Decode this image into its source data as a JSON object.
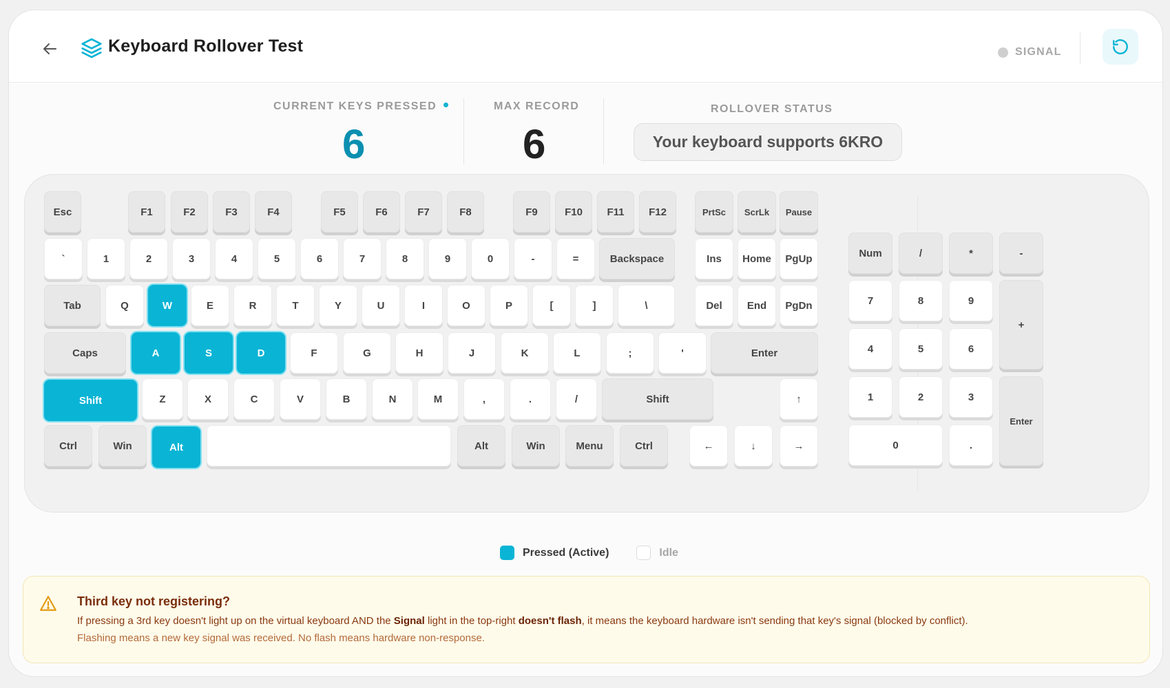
{
  "header": {
    "title": "Keyboard Rollover Test",
    "signal_label": "SIGNAL"
  },
  "stats": {
    "current_label": "CURRENT KEYS PRESSED",
    "current_value": "6",
    "max_label": "MAX RECORD",
    "max_value": "6",
    "status_label": "ROLLOVER STATUS",
    "status_text": "Your keyboard supports 6KRO"
  },
  "keyboard": {
    "keys": [
      {
        "id": "Esc",
        "label": "Esc"
      },
      {
        "id": "F1",
        "label": "F1"
      },
      {
        "id": "F2",
        "label": "F2"
      },
      {
        "id": "F3",
        "label": "F3"
      },
      {
        "id": "F4",
        "label": "F4"
      },
      {
        "id": "F5",
        "label": "F5"
      },
      {
        "id": "F6",
        "label": "F6"
      },
      {
        "id": "F7",
        "label": "F7"
      },
      {
        "id": "F8",
        "label": "F8"
      },
      {
        "id": "F9",
        "label": "F9"
      },
      {
        "id": "F10",
        "label": "F10"
      },
      {
        "id": "F11",
        "label": "F11"
      },
      {
        "id": "F12",
        "label": "F12"
      },
      {
        "id": "PrtSc",
        "label": "PrtSc"
      },
      {
        "id": "ScrLk",
        "label": "ScrLk"
      },
      {
        "id": "Pause",
        "label": "Pause"
      },
      {
        "id": "Backquote",
        "label": "`"
      },
      {
        "id": "1",
        "label": "1"
      },
      {
        "id": "2",
        "label": "2"
      },
      {
        "id": "3",
        "label": "3"
      },
      {
        "id": "4",
        "label": "4"
      },
      {
        "id": "5",
        "label": "5"
      },
      {
        "id": "6",
        "label": "6"
      },
      {
        "id": "7",
        "label": "7"
      },
      {
        "id": "8",
        "label": "8"
      },
      {
        "id": "9",
        "label": "9"
      },
      {
        "id": "0",
        "label": "0"
      },
      {
        "id": "Minus",
        "label": "-"
      },
      {
        "id": "Equal",
        "label": "="
      },
      {
        "id": "Backspace",
        "label": "Backspace"
      },
      {
        "id": "Ins",
        "label": "Ins"
      },
      {
        "id": "Home",
        "label": "Home"
      },
      {
        "id": "PgUp",
        "label": "PgUp"
      },
      {
        "id": "Tab",
        "label": "Tab"
      },
      {
        "id": "Q",
        "label": "Q"
      },
      {
        "id": "W",
        "label": "W"
      },
      {
        "id": "E",
        "label": "E"
      },
      {
        "id": "R",
        "label": "R"
      },
      {
        "id": "T",
        "label": "T"
      },
      {
        "id": "Y",
        "label": "Y"
      },
      {
        "id": "U",
        "label": "U"
      },
      {
        "id": "I",
        "label": "I"
      },
      {
        "id": "O",
        "label": "O"
      },
      {
        "id": "P",
        "label": "P"
      },
      {
        "id": "BracketLeft",
        "label": "["
      },
      {
        "id": "BracketRight",
        "label": "]"
      },
      {
        "id": "Backslash",
        "label": "\\"
      },
      {
        "id": "Del",
        "label": "Del"
      },
      {
        "id": "End",
        "label": "End"
      },
      {
        "id": "PgDn",
        "label": "PgDn"
      },
      {
        "id": "Caps",
        "label": "Caps"
      },
      {
        "id": "A",
        "label": "A"
      },
      {
        "id": "S",
        "label": "S"
      },
      {
        "id": "D",
        "label": "D"
      },
      {
        "id": "F",
        "label": "F"
      },
      {
        "id": "G",
        "label": "G"
      },
      {
        "id": "H",
        "label": "H"
      },
      {
        "id": "J",
        "label": "J"
      },
      {
        "id": "K",
        "label": "K"
      },
      {
        "id": "L",
        "label": "L"
      },
      {
        "id": "Semicolon",
        "label": ";"
      },
      {
        "id": "Quote",
        "label": "'"
      },
      {
        "id": "Enter",
        "label": "Enter"
      },
      {
        "id": "ShiftLeft",
        "label": "Shift"
      },
      {
        "id": "Z",
        "label": "Z"
      },
      {
        "id": "X",
        "label": "X"
      },
      {
        "id": "C",
        "label": "C"
      },
      {
        "id": "V",
        "label": "V"
      },
      {
        "id": "B",
        "label": "B"
      },
      {
        "id": "N",
        "label": "N"
      },
      {
        "id": "M",
        "label": "M"
      },
      {
        "id": "Comma",
        "label": ","
      },
      {
        "id": "Period",
        "label": "."
      },
      {
        "id": "Slash",
        "label": "/"
      },
      {
        "id": "ShiftRight",
        "label": "Shift"
      },
      {
        "id": "ArrowUp",
        "label": "↑"
      },
      {
        "id": "CtrlLeft",
        "label": "Ctrl"
      },
      {
        "id": "WinLeft",
        "label": "Win"
      },
      {
        "id": "AltLeft",
        "label": "Alt"
      },
      {
        "id": "Space",
        "label": ""
      },
      {
        "id": "AltRight",
        "label": "Alt"
      },
      {
        "id": "WinRight",
        "label": "Win"
      },
      {
        "id": "Menu",
        "label": "Menu"
      },
      {
        "id": "CtrlRight",
        "label": "Ctrl"
      },
      {
        "id": "ArrowLeft",
        "label": "←"
      },
      {
        "id": "ArrowDown",
        "label": "↓"
      },
      {
        "id": "ArrowRight",
        "label": "→"
      },
      {
        "id": "NumLock",
        "label": "Num"
      },
      {
        "id": "NumDivide",
        "label": "/"
      },
      {
        "id": "NumMultiply",
        "label": "*"
      },
      {
        "id": "NumSubtract",
        "label": "-"
      },
      {
        "id": "Num7",
        "label": "7"
      },
      {
        "id": "Num8",
        "label": "8"
      },
      {
        "id": "Num9",
        "label": "9"
      },
      {
        "id": "NumAdd",
        "label": "+"
      },
      {
        "id": "Num4",
        "label": "4"
      },
      {
        "id": "Num5",
        "label": "5"
      },
      {
        "id": "Num6",
        "label": "6"
      },
      {
        "id": "Num1",
        "label": "1"
      },
      {
        "id": "Num2",
        "label": "2"
      },
      {
        "id": "Num3",
        "label": "3"
      },
      {
        "id": "NumEnter",
        "label": "Enter"
      },
      {
        "id": "Num0",
        "label": "0"
      },
      {
        "id": "NumDecimal",
        "label": "."
      }
    ],
    "pressed": [
      "W",
      "A",
      "S",
      "D",
      "ShiftLeft",
      "AltLeft"
    ]
  },
  "legend": {
    "pressed": "Pressed (Active)",
    "idle": "Idle"
  },
  "notice": {
    "title": "Third key not registering?",
    "line1_a": "If pressing a 3rd key doesn't light up on the virtual keyboard AND the ",
    "line1_b": "Signal",
    "line1_c": " light in the top-right ",
    "line1_d": "doesn't flash",
    "line1_e": ", it means the keyboard hardware isn't sending that key's signal (blocked by conflict).",
    "line2": "Flashing means a new key signal was received. No flash means hardware non-response."
  },
  "colors": {
    "accent": "#0ab4d5",
    "signal_idle": "#cfcfcf",
    "notice_bg": "#fffbea"
  }
}
